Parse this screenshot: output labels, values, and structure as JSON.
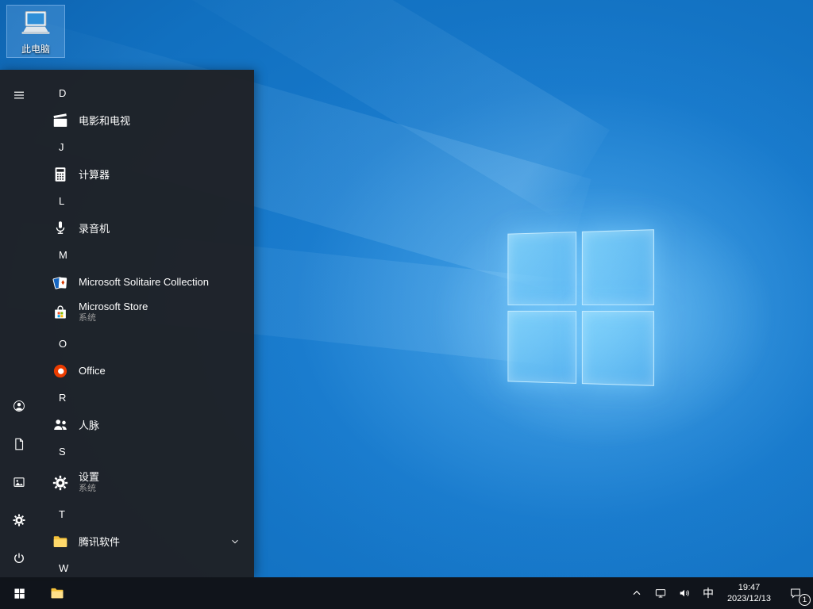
{
  "desktop": {
    "this_pc_label": "此电脑"
  },
  "start_menu": {
    "rail_icons": [
      "hamburger-menu",
      "user-account",
      "documents",
      "pictures",
      "settings-gear",
      "power"
    ],
    "sections": [
      {
        "letter": "D",
        "apps": [
          {
            "label": "电影和电视",
            "icon": "movies-tv-icon"
          }
        ]
      },
      {
        "letter": "J",
        "apps": [
          {
            "label": "计算器",
            "icon": "calculator-icon"
          }
        ]
      },
      {
        "letter": "L",
        "apps": [
          {
            "label": "录音机",
            "icon": "voice-recorder-icon"
          }
        ]
      },
      {
        "letter": "M",
        "apps": [
          {
            "label": "Microsoft Solitaire Collection",
            "icon": "solitaire-icon"
          },
          {
            "label": "Microsoft Store",
            "sublabel": "系统",
            "icon": "store-icon"
          }
        ]
      },
      {
        "letter": "O",
        "apps": [
          {
            "label": "Office",
            "icon": "office-icon"
          }
        ]
      },
      {
        "letter": "R",
        "apps": [
          {
            "label": "人脉",
            "icon": "people-icon"
          }
        ]
      },
      {
        "letter": "S",
        "apps": [
          {
            "label": "设置",
            "sublabel": "系统",
            "icon": "settings-icon"
          }
        ]
      },
      {
        "letter": "T",
        "apps": [
          {
            "label": "腾讯软件",
            "icon": "folder-icon",
            "expandable": true
          }
        ]
      },
      {
        "letter": "W",
        "apps": []
      }
    ]
  },
  "taskbar": {
    "ime_label": "中",
    "time": "19:47",
    "date": "2023/12/13",
    "notification_badge": "1"
  },
  "colors": {
    "accent_blue": "#0078d7",
    "menu_bg": "#1f2126",
    "taskbar_bg": "#101217",
    "folder_yellow": "#ffd96b",
    "office_orange": "#eb3c00",
    "ms_red": "#f25022",
    "ms_green": "#7fba00",
    "ms_blue": "#00a4ef",
    "ms_yellow": "#ffb900"
  }
}
